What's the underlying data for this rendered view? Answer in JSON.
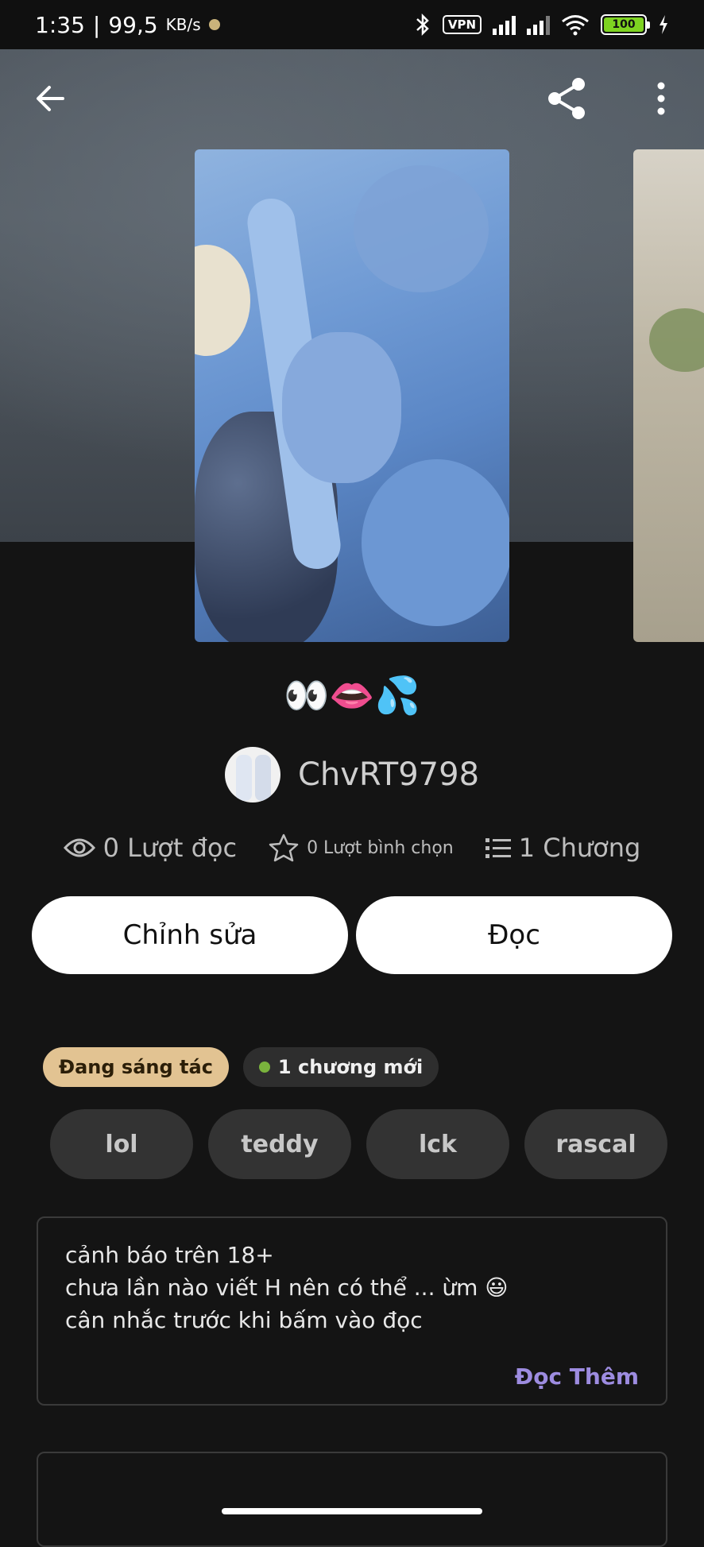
{
  "status_bar": {
    "time": "1:35",
    "network_speed": "99,5",
    "network_unit": "KB/s",
    "vpn": "VPN",
    "battery": "100"
  },
  "story": {
    "title": "👀👄💦",
    "author": "ChvRT9798",
    "stats": {
      "reads": "0 Lượt đọc",
      "votes": "0 Lượt bình chọn",
      "chapters": "1 Chương"
    },
    "edit_label": "Chỉnh sửa",
    "read_label": "Đọc",
    "status_badge": "Đang sáng tác",
    "new_chapter_badge": "1 chương mới",
    "tags": [
      "lol",
      "teddy",
      "lck",
      "rascal"
    ],
    "description": [
      "cảnh báo trên 18+",
      "chưa lần nào viết H nên có thể ... ừm 😃",
      "cân nhắc trước khi bấm vào đọc"
    ],
    "read_more": "Đọc Thêm"
  },
  "icons": {
    "back": "arrow-left-icon",
    "share": "share-icon",
    "more": "more-vertical-icon",
    "reads": "eye-icon",
    "votes": "star-icon",
    "chapters": "list-icon"
  },
  "colors": {
    "background": "#141414",
    "status_badge": "#e2c392",
    "read_more": "#9d8ce0",
    "new_dot": "#7ab33d"
  }
}
